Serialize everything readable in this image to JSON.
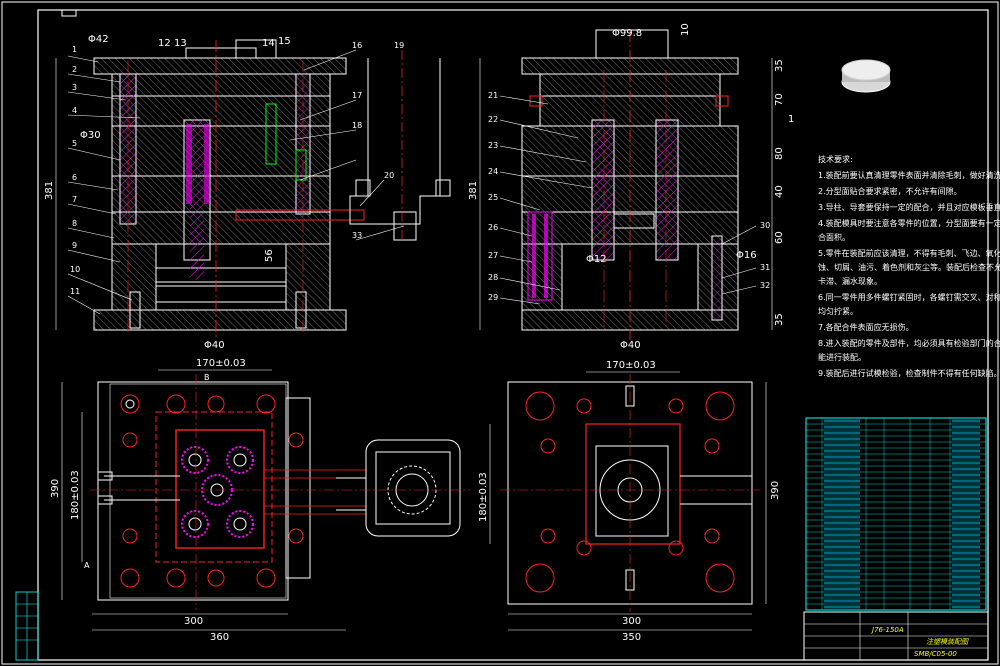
{
  "dimensions": {
    "top_left": {
      "width_42": "Φ42",
      "d12": "12",
      "d13": "13",
      "d14": "14",
      "d15": "15",
      "d30": "Φ30",
      "height_381": "381",
      "d56": "56",
      "d40": "Φ40"
    },
    "top_right": {
      "d99": "Φ99.8",
      "d10": "10",
      "height_381": "381",
      "d35a": "35",
      "d70": "70",
      "d80": "80",
      "d40": "40",
      "d60": "60",
      "d35b": "35",
      "d12": "Φ12",
      "d16": "Φ16",
      "d40_bottom": "Φ40",
      "d1": "1"
    },
    "bottom_left": {
      "top_170": "170±0.03",
      "side_180": "180±0.03",
      "side_390": "390",
      "bot_300": "300",
      "bot_360": "360",
      "sec_a": "A",
      "sec_b": "B"
    },
    "bottom_right": {
      "top_170": "170±0.03",
      "side_180": "180±0.03",
      "side_390": "390",
      "bot_300": "300",
      "bot_350": "350"
    }
  },
  "part_labels_left": [
    "1",
    "2",
    "3",
    "4",
    "5",
    "6",
    "7",
    "8",
    "9",
    "10",
    "11"
  ],
  "part_labels_mid": [
    "16",
    "17",
    "18",
    "19",
    "20",
    "33"
  ],
  "part_labels_right": [
    "21",
    "22",
    "23",
    "24",
    "25",
    "26",
    "27",
    "28",
    "29",
    "30",
    "31",
    "32"
  ],
  "notes": {
    "title": "技术要求:",
    "lines": [
      "1.装配前要认真清理零件表面并清除毛刺，做好清洗工作。",
      "2.分型面贴合要求紧密，不允许有间隙。",
      "3.导柱、导套要保持一定的配合，并且对应模板垂直度要好。",
      "4.装配模具时要注意各零件的位置，分型面要有一定的贴",
      "  合面积。",
      "5.零件在装配前应该清理，不得有毛刺、飞边、氧化皮、锈",
      "  蚀、切屑、油污、着色剂和灰尘等。装配后检查不允许有",
      "  卡滞、漏水现象。",
      "6.同一零件用多件螺钉紧固时，各螺钉需交叉、对称、逐步",
      "  均匀拧紧。",
      "7.各配合件表面应无损伤。",
      "8.进入装配的零件及部件，均必须具有检验部门的合格证方",
      "  能进行装配。",
      "9.装配后进行试模检验，检查制件不得有任何缺陷。"
    ]
  },
  "title_block": {
    "drawing_code": "J76-150A",
    "drawing_name": "注塑模装配图",
    "drawing_no": "SMB/C05-00"
  },
  "colors": {
    "background": "#000000",
    "outline": "#ffffff",
    "hatch": "#ff00ff",
    "centerline": "#ff2020",
    "dimension": "#00ff00",
    "hidden": "#ffff00",
    "table": "#00ffff"
  }
}
